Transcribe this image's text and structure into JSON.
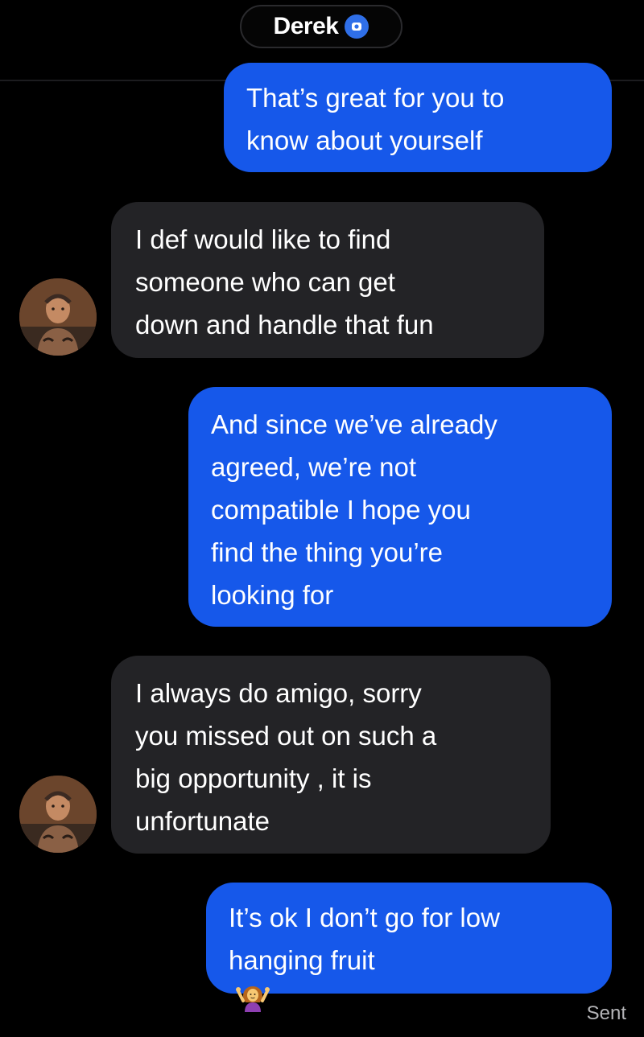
{
  "header": {
    "contact_name": "Derek",
    "verified_icon": "verified-badge-icon"
  },
  "messages": [
    {
      "direction": "sent",
      "lines": [
        "That’s great for you to",
        "know about yourself"
      ]
    },
    {
      "direction": "received",
      "lines": [
        "I def would like to find",
        "someone who can get",
        "down and handle that fun"
      ]
    },
    {
      "direction": "sent",
      "lines": [
        "And since we’ve already",
        "agreed, we’re not",
        "compatible I hope you",
        "find the thing you’re",
        "looking for"
      ]
    },
    {
      "direction": "received",
      "lines": [
        "I always do amigo, sorry",
        "you missed out on such a",
        "big opportunity , it is",
        "unfortunate"
      ]
    },
    {
      "direction": "sent",
      "lines": [
        "It’s ok I don’t go for low",
        "hanging fruit"
      ],
      "emoji": "shrugging-woman-emoji"
    }
  ],
  "status": {
    "delivery": "Sent"
  },
  "colors": {
    "background": "#000000",
    "sent_bubble": "#1658ea",
    "received_bubble": "#232326",
    "verified_badge": "#2f6fe8"
  }
}
